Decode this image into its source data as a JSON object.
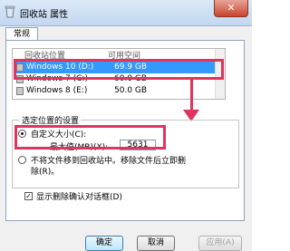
{
  "window": {
    "title": "回收站 属性",
    "close_label": "✕"
  },
  "tabs": [
    {
      "label": "常规"
    }
  ],
  "drives_list": {
    "col_location": "回收站位置",
    "col_space": "可用空间",
    "rows": [
      {
        "name": "Windows 10 (D:)",
        "space": "69.9 GB",
        "selected": true
      },
      {
        "name": "Windows 7 (C:)",
        "space": "60.0 GB",
        "selected": false
      },
      {
        "name": "Windows 8 (E:)",
        "space": "50.0 GB",
        "selected": false
      }
    ]
  },
  "settings": {
    "group_label": "选定位置的设置",
    "custom_size_label": "自定义大小(C):",
    "max_value_label": "最大值(MB)(X):",
    "max_value": "5631",
    "no_move_label_line1": "不将文件移到回收站中。移除文件后立即删",
    "no_move_label_line2": "除(R)。"
  },
  "confirm_dialog_label": "显示删除确认对话框(D)",
  "buttons": {
    "ok": "确定",
    "cancel": "取消",
    "apply": "应用(A)"
  },
  "colors": {
    "highlight": "#e0335f",
    "selection": "#3399ff"
  }
}
